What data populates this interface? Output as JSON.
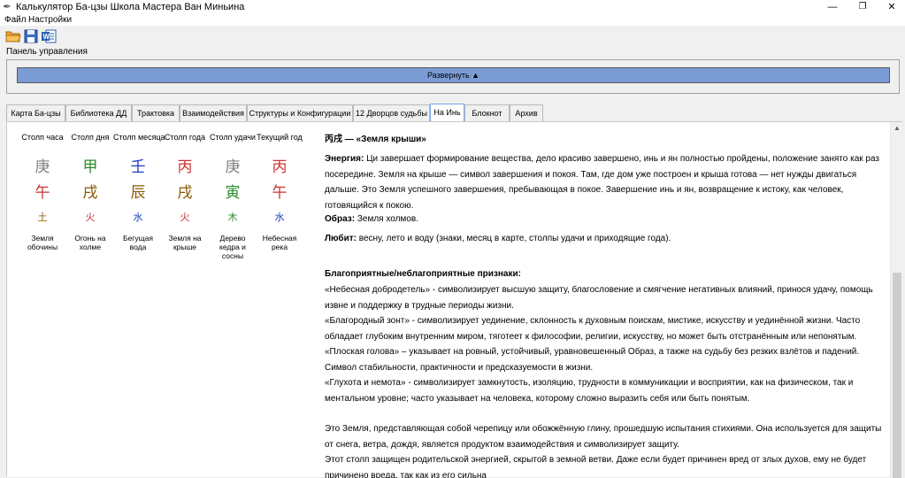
{
  "window": {
    "title": "Калькулятор Ба-цзы Школа Мастера Ван Миньина",
    "minimize": "—",
    "maximize": "❐",
    "close": "✕"
  },
  "menu": [
    "Файл",
    "Настройки"
  ],
  "toolbar": {
    "icons": [
      "open-folder-icon",
      "save-icon",
      "word-export-icon"
    ]
  },
  "control_panel": {
    "label": "Панель управления",
    "expand_button": "Развернуть ▲"
  },
  "tabs": [
    {
      "label": "Карта Ба-цзы"
    },
    {
      "label": "Библиотека ДД"
    },
    {
      "label": "Трактовка"
    },
    {
      "label": "Взаимодействия"
    },
    {
      "label": "Структуры и Конфигурации"
    },
    {
      "label": "12 Дворцов судьбы"
    },
    {
      "label": "На Инь",
      "active": true
    },
    {
      "label": "Блокнот"
    },
    {
      "label": "Архив"
    }
  ],
  "pillars": [
    {
      "header": "Столп часа",
      "stem": "庚",
      "stem_color": "#808080",
      "branch": "午",
      "branch_color": "#cc3333",
      "element": "土",
      "element_color": "#8b5a00",
      "name": "Земля обочины"
    },
    {
      "header": "Столп дня",
      "stem": "甲",
      "stem_color": "#2e8b2e",
      "branch": "戌",
      "branch_color": "#8b5a00",
      "element": "火",
      "element_color": "#cc3333",
      "name": "Огонь на холме"
    },
    {
      "header": "Столп месяца",
      "stem": "壬",
      "stem_color": "#1f3fbf",
      "branch": "辰",
      "branch_color": "#8b5a00",
      "element": "水",
      "element_color": "#1f3fbf",
      "name": "Бегущая вода"
    },
    {
      "header": "Столп года",
      "stem": "丙",
      "stem_color": "#cc3333",
      "branch": "戌",
      "branch_color": "#8b5a00",
      "element": "火",
      "element_color": "#cc3333",
      "name": "Земля на крыше"
    },
    {
      "header": "Столп удачи",
      "stem": "庚",
      "stem_color": "#808080",
      "branch": "寅",
      "branch_color": "#2e8b2e",
      "element": "木",
      "element_color": "#2e8b2e",
      "name": "Дерево кедра и сосны"
    },
    {
      "header": "Текущий год",
      "stem": "丙",
      "stem_color": "#cc3333",
      "branch": "午",
      "branch_color": "#cc3333",
      "element": "水",
      "element_color": "#1f3fbf",
      "name": "Небесная река"
    }
  ],
  "description": {
    "title": "丙戌 — «Земля крыши»",
    "energy_label": "Энергия:",
    "energy_text": "Ци завершает формирование вещества, дело красиво завершено, инь и ян полностью пройдены, положение занято как раз посередине. Земля на крыше — символ завершения и покоя. Там, где дом уже построен и крыша готова — нет нужды двигаться дальше. Это Земля успешного завершения, пребывающая в покое. Завершение инь и ян, возвращение к истоку, как человек, готовящийся к покою.",
    "image_label": "Образ:",
    "image_text": "Земля холмов.",
    "likes_label": "Любит:",
    "likes_text": "весну, лето и воду (знаки, месяц в карте, столпы удачи и приходящие года).",
    "signs_title": "Благоприятные/неблагоприятные признаки:",
    "sign1": "«Небесная добродетель» - символизирует высшую защиту, благословение и смягчение негативных влияний, принося удачу, помощь извне и поддержку в трудные периоды жизни.",
    "sign2": "«Благородный зонт» - символизирует уединение, склонность к духовным поискам, мистике, искусству и уединённой жизни. Часто обладает глубоким внутренним миром, тяготеет к философии, религии, искусству, но может быть отстранённым или непонятым.",
    "sign3": "«Плоская голова» – указывает на ровный, устойчивый, уравновешенный Образ, а также на судьбу без резких взлётов и падений. Символ стабильности, практичности и предсказуемости в жизни.",
    "sign4": "«Глухота и немота» - символизирует замкнутость, изоляцию, трудности в коммуникации и восприятии, как на физическом, так и ментальном уровне; часто указывает на человека, которому сложно выразить себя или быть понятым.",
    "para1": "Это Земля, представляющая собой черепицу или обожжённую глину, прошедшую испытания стихиями. Она используется для защиты от снега, ветра, дождя, является продуктом взаимодействия и символизирует защиту.",
    "para2": "Этот столп защищен родительской энергией, скрытой в земной ветви. Даже если будет причинен вред от злых духов, ему не будет причинено вреда, так как из его сильна"
  },
  "colors": {
    "expand_button_bg": "#7b9bd4",
    "active_tab_border": "#7aa7e8"
  }
}
